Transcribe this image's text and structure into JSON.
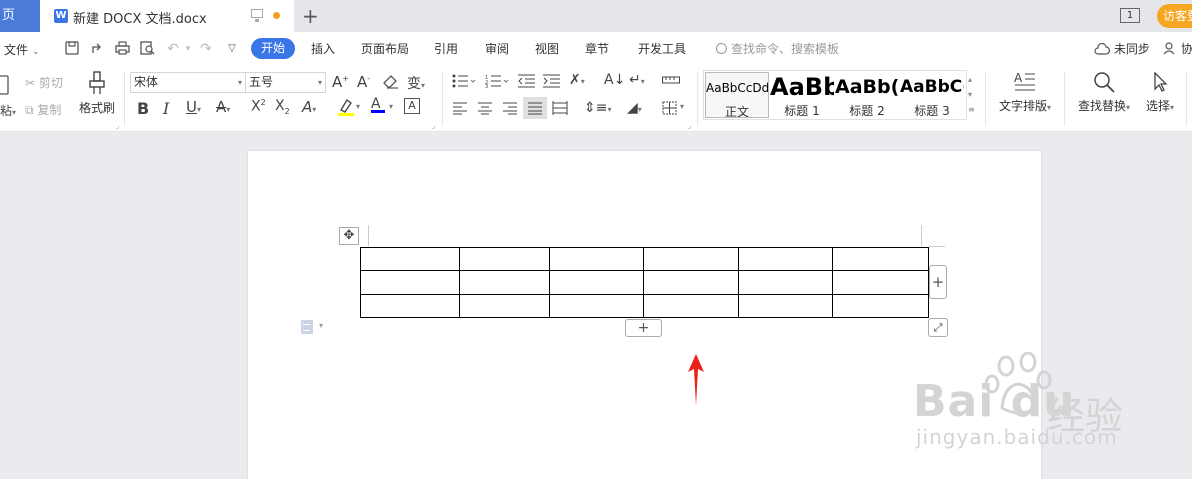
{
  "titlebar": {
    "home_tab": "页",
    "doc_tab_title": "新建 DOCX 文档.docx",
    "doc_tab_icon": "W",
    "new_tab": "+",
    "page_icon_label": "1",
    "visitor_label": "访客登"
  },
  "menubar": {
    "file_label": "文件",
    "tabs": [
      "开始",
      "插入",
      "页面布局",
      "引用",
      "审阅",
      "视图",
      "章节",
      "开发工具"
    ],
    "active_tab": "开始",
    "search_placeholder": "查找命令、搜索模板",
    "sync_label": "未同步",
    "share_label": "协"
  },
  "ribbon": {
    "paste_label": "粘",
    "cut_label": "剪切",
    "copy_label": "复制",
    "format_painter_label": "格式刷",
    "font_name": "宋体",
    "font_size": "五号",
    "styles": [
      {
        "sample": "AaBbCcDd",
        "name": "正文"
      },
      {
        "sample": "AaBb",
        "name": "标题 1"
      },
      {
        "sample": "AaBb(",
        "name": "标题 2"
      },
      {
        "sample": "AaBbC(",
        "name": "标题 3"
      }
    ],
    "text_layout_label": "文字排版",
    "find_replace_label": "查找替换",
    "select_label": "选择"
  },
  "document": {
    "table": {
      "rows": 3,
      "cols": 6
    },
    "add_row_label": "+",
    "add_col_label": "+"
  },
  "watermark": {
    "brand": "Bai du",
    "cn": "经验",
    "url": "jingyan.baidu.com"
  },
  "colors": {
    "accent": "#3b76e6",
    "visitor": "#f5a623",
    "arrow": "#e8231a",
    "font_color_bar": "#0000ff",
    "highlight_bar": "#ffff00"
  }
}
